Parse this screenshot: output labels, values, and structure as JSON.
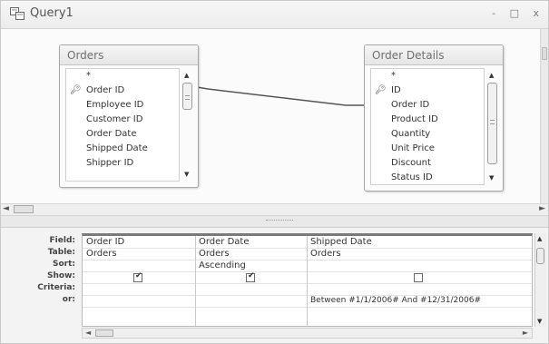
{
  "window": {
    "title": "Query1",
    "controls": "- □ x"
  },
  "tables": [
    {
      "name": "Orders",
      "fields": [
        "*",
        "Order ID",
        "Employee ID",
        "Customer ID",
        "Order Date",
        "Shipped Date",
        "Shipper ID"
      ],
      "primary_key_field": "Order ID"
    },
    {
      "name": "Order Details",
      "fields": [
        "*",
        "ID",
        "Order ID",
        "Product ID",
        "Quantity",
        "Unit Price",
        "Discount",
        "Status ID"
      ],
      "primary_key_field": "ID"
    }
  ],
  "grid": {
    "row_labels": [
      "Field:",
      "Table:",
      "Sort:",
      "Show:",
      "Criteria:",
      "or:"
    ],
    "columns": [
      {
        "field": "Order ID",
        "table": "Orders",
        "sort": "",
        "show": true,
        "criteria": ""
      },
      {
        "field": "Order Date",
        "table": "Orders",
        "sort": "Ascending",
        "show": true,
        "criteria": ""
      },
      {
        "field": "Shipped Date",
        "table": "Orders",
        "sort": "",
        "show": false,
        "criteria": "Between #1/1/2006# And #12/31/2006#"
      }
    ]
  },
  "icons": {
    "window": "query-window-icon",
    "key": "primary-key-icon",
    "check": "✔",
    "arrow_up": "▲",
    "arrow_down": "▼",
    "arrow_left": "◄",
    "arrow_right": "►"
  }
}
